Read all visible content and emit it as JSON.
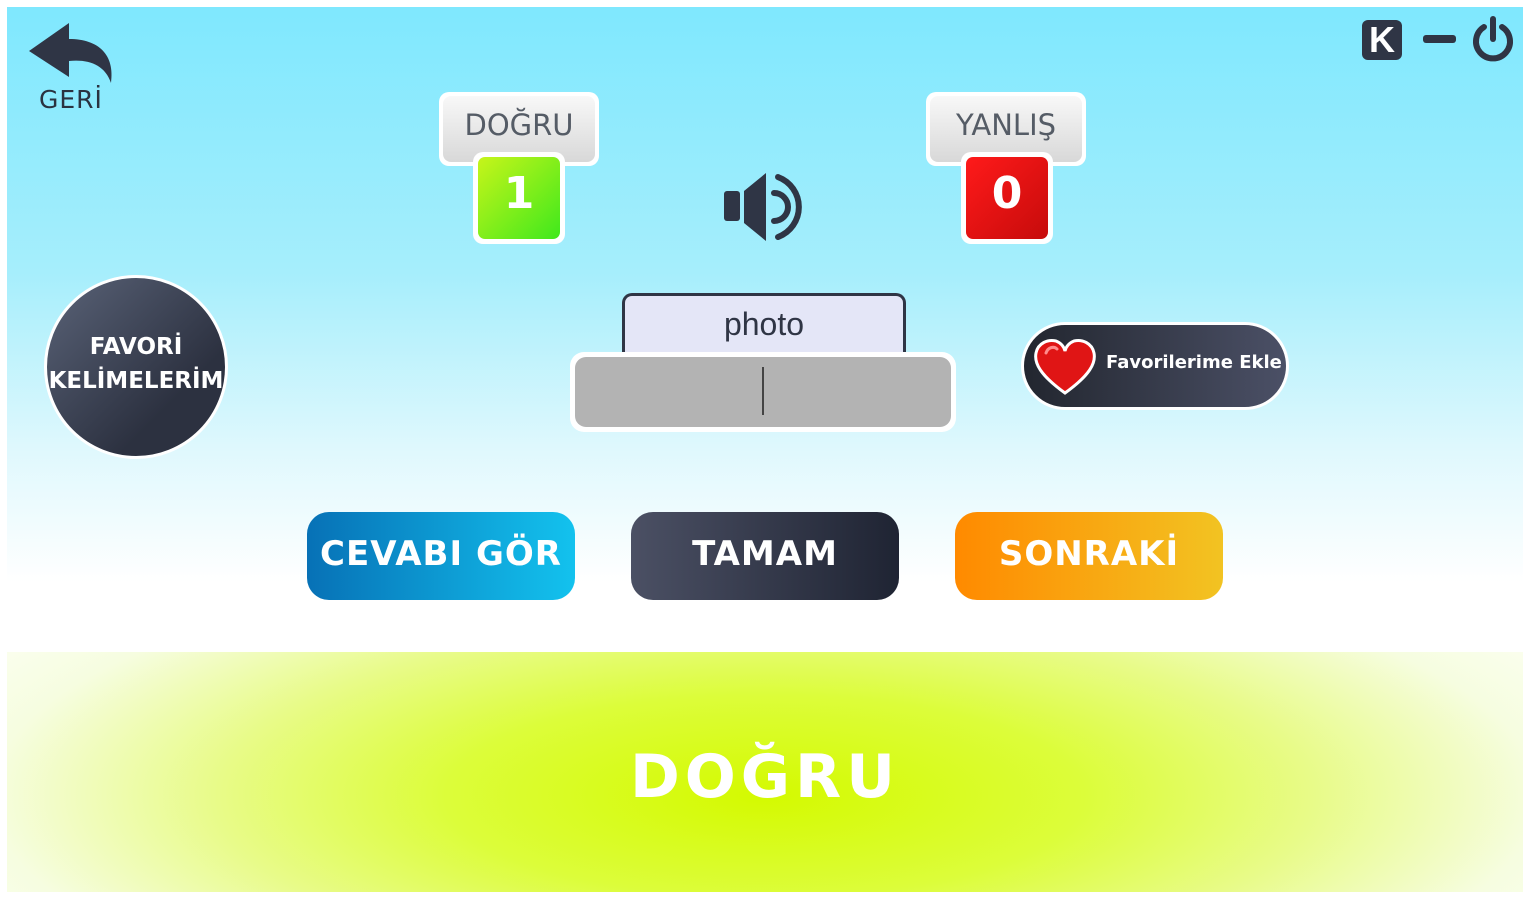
{
  "header": {
    "back_label": "GERİ",
    "k_label": "K"
  },
  "score": {
    "correct_label": "DOĞRU",
    "correct_value": "1",
    "correct_color": "#5fe21a",
    "wrong_label": "YANLIŞ",
    "wrong_value": "0",
    "wrong_color": "#e00a0a"
  },
  "favorites": {
    "circle_line1": "FAVORİ",
    "circle_line2": "KELİMELERİM",
    "add_label": "Favorilerime Ekle"
  },
  "quiz": {
    "word": "photo",
    "answer_value": ""
  },
  "actions": {
    "show_answer": "CEVABI GÖR",
    "ok": "TAMAM",
    "next": "SONRAKİ"
  },
  "result": {
    "text": "DOĞRU"
  },
  "icons": {
    "back": "back-arrow-icon",
    "speaker": "speaker-icon",
    "minimize": "minimize-icon",
    "power": "power-icon",
    "heart": "heart-icon"
  }
}
